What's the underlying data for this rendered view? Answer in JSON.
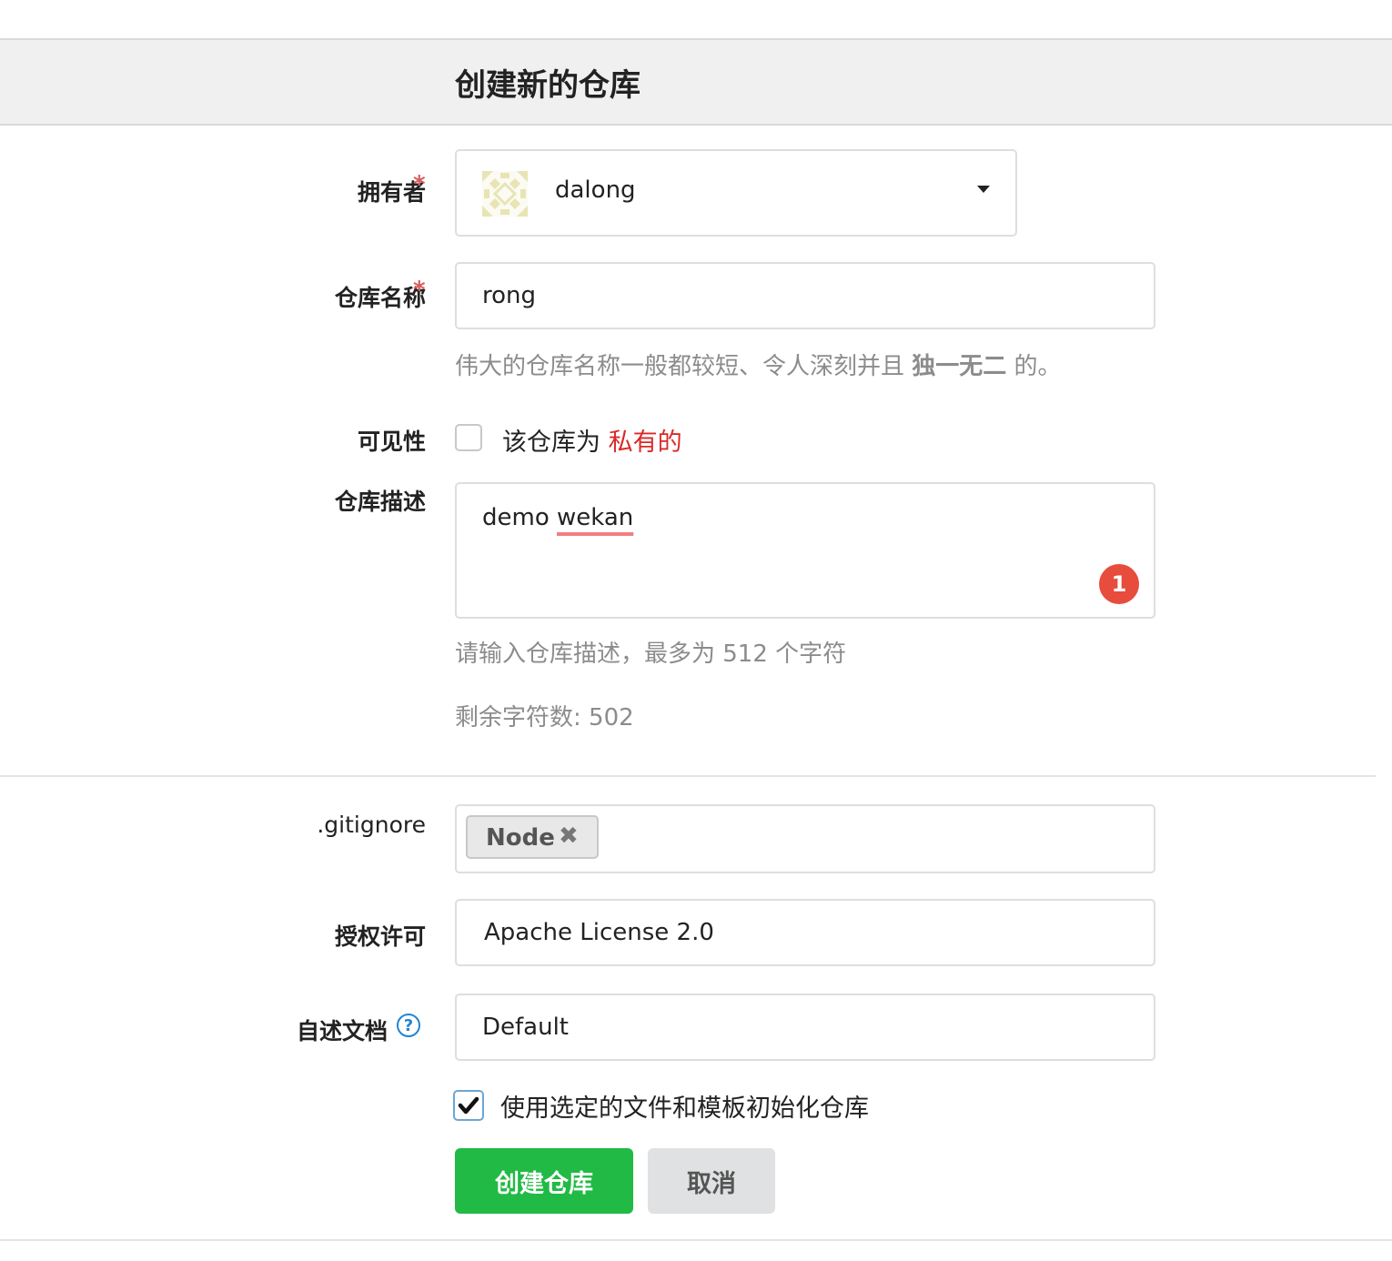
{
  "header": {
    "title": "创建新的仓库"
  },
  "owner": {
    "label": "拥有者",
    "required_mark": "*",
    "value": "dalong",
    "dropdown_icon": "caret-down-icon"
  },
  "repo_name": {
    "label": "仓库名称",
    "required_mark": "*",
    "value": "rong",
    "help_prefix": "伟大的仓库名称一般都较短、令人深刻并且 ",
    "help_bold": "独一无二",
    "help_suffix": " 的。"
  },
  "visibility": {
    "label": "可见性",
    "checked": false,
    "text_prefix": "该仓库为 ",
    "text_private": "私有的"
  },
  "description": {
    "label": "仓库描述",
    "word1": "demo",
    "word2": "wekan",
    "badge": "1",
    "help": "请输入仓库描述，最多为 512 个字符",
    "remaining": "剩余字符数: 502"
  },
  "gitignore": {
    "label": ".gitignore",
    "tags": [
      {
        "label": "Node",
        "remove_icon": "close-icon"
      }
    ]
  },
  "license": {
    "label": "授权许可",
    "value": "Apache License 2.0"
  },
  "readme": {
    "label": "自述文档",
    "help_icon": "question-circle-icon",
    "value": "Default"
  },
  "auto_init": {
    "checked": true,
    "label": "使用选定的文件和模板初始化仓库"
  },
  "buttons": {
    "create": "创建仓库",
    "cancel": "取消"
  },
  "colors": {
    "primary_green": "#21ba45",
    "required_red": "#d95c5c",
    "private_red": "#db2828",
    "badge_red": "#e74c3c",
    "help_blue": "#2185d0"
  }
}
